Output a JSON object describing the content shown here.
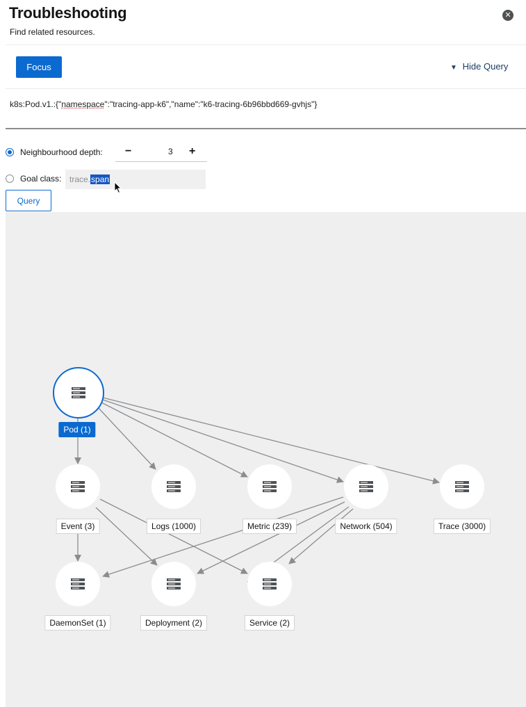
{
  "header": {
    "title": "Troubleshooting",
    "subtitle": "Find related resources.",
    "close_icon": "close-icon"
  },
  "toolbar": {
    "focus_label": "Focus",
    "hide_query_label": "Hide Query"
  },
  "query": {
    "prefix": "k8s:Pod.v1.:{\"",
    "ns_key": "namespace",
    "middle": "\":\"tracing-app-k6\",\"name\":\"k6-tracing-6b96bbd669-gvhjs\"}"
  },
  "options": {
    "depth_label": "Neighbourhood depth:",
    "depth_value": "3",
    "minus": "−",
    "plus": "+",
    "goal_label": "Goal class:",
    "goal_value_plain": "trace.",
    "goal_value_selected": "span",
    "query_button": "Query"
  },
  "graph": {
    "nodes": [
      {
        "id": "pod",
        "label": "Pod (1)",
        "selected": true
      },
      {
        "id": "event",
        "label": "Event (3)"
      },
      {
        "id": "logs",
        "label": "Logs (1000)"
      },
      {
        "id": "metric",
        "label": "Metric (239)"
      },
      {
        "id": "network",
        "label": "Network (504)"
      },
      {
        "id": "trace",
        "label": "Trace (3000)"
      },
      {
        "id": "daemonset",
        "label": "DaemonSet (1)"
      },
      {
        "id": "deployment",
        "label": "Deployment (2)"
      },
      {
        "id": "service",
        "label": "Service (2)"
      }
    ],
    "colors": {
      "edge": "#8a8d90",
      "node_fill": "#ffffff",
      "selected": "#0b6ad0",
      "icon": "#4f5255"
    }
  }
}
